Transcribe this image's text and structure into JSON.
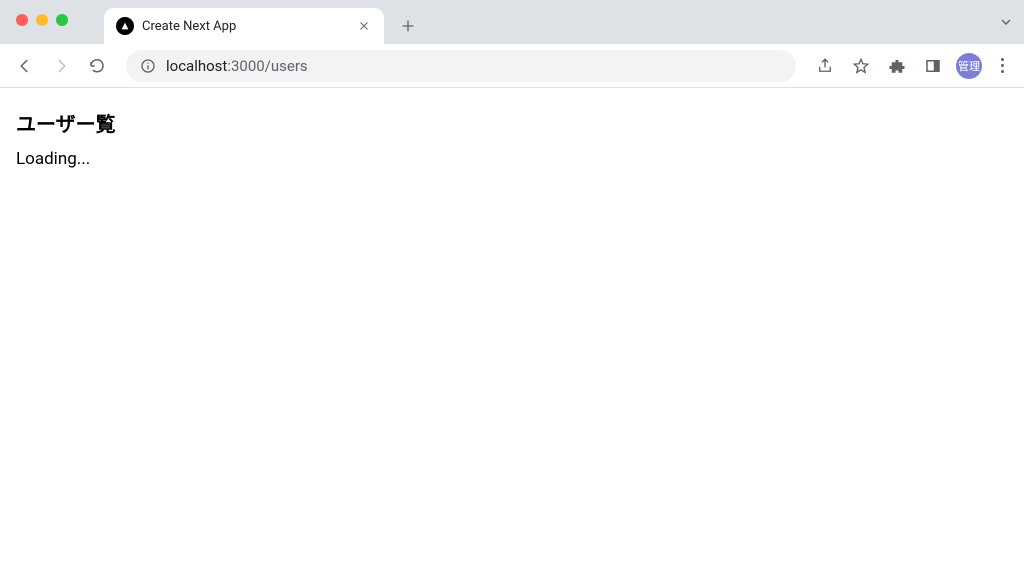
{
  "browser": {
    "tab_title": "Create Next App",
    "url_host": "localhost",
    "url_port_path": ":3000/users",
    "profile_label": "管理"
  },
  "page": {
    "heading": "ユーザー覧",
    "loading": "Loading..."
  }
}
